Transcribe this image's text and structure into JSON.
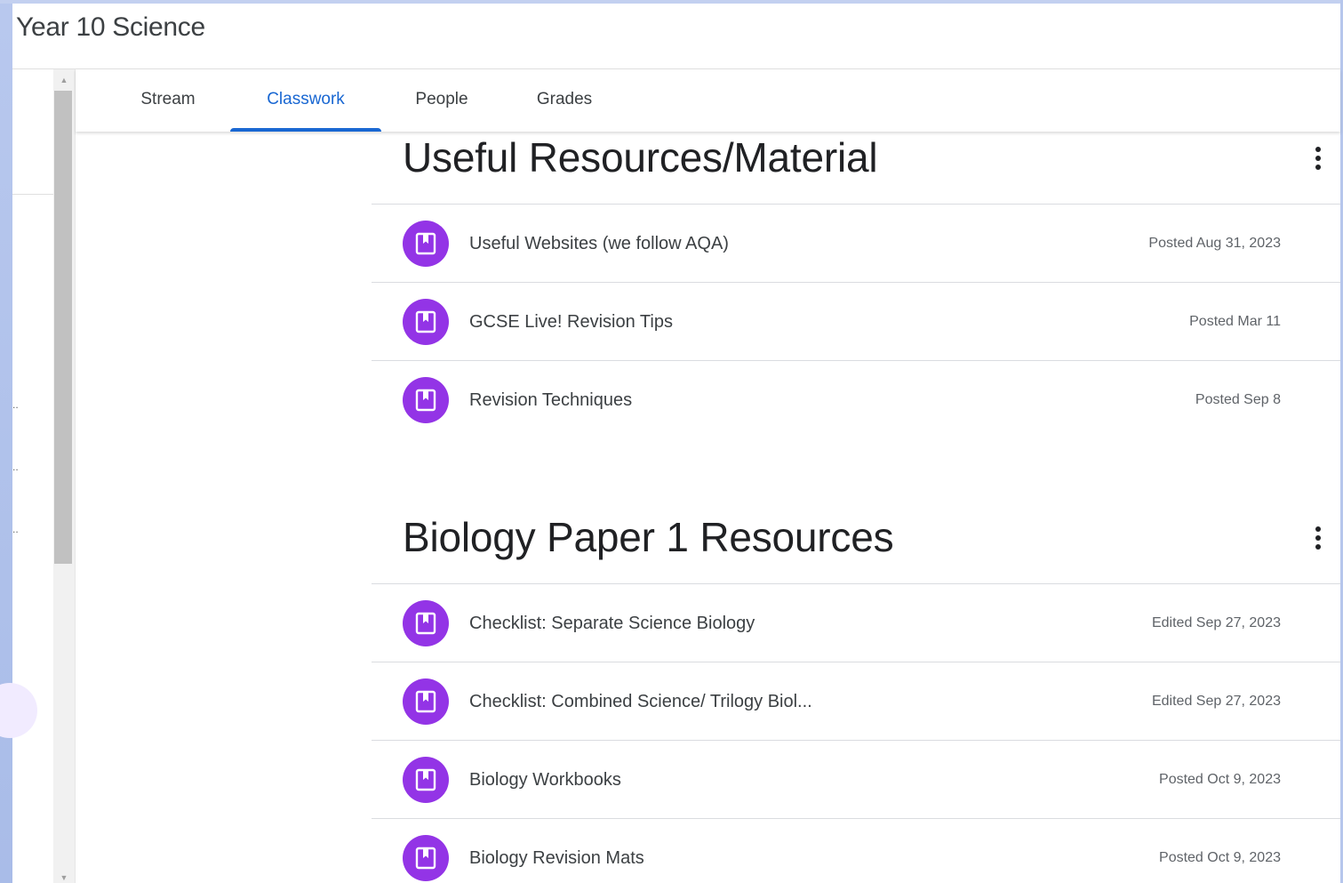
{
  "header": {
    "class_title": "Year 10 Science"
  },
  "tabs": [
    {
      "label": "Stream",
      "active": false
    },
    {
      "label": "Classwork",
      "active": true
    },
    {
      "label": "People",
      "active": false
    },
    {
      "label": "Grades",
      "active": false
    }
  ],
  "topics": [
    {
      "title": "Useful Resources/Material",
      "items": [
        {
          "name": "Useful Websites (we follow AQA)",
          "date": "Posted Aug 31, 2023"
        },
        {
          "name": "GCSE Live! Revision Tips",
          "date": "Posted Mar 11"
        },
        {
          "name": "Revision Techniques",
          "date": "Posted Sep 8"
        }
      ]
    },
    {
      "title": "Biology Paper 1 Resources",
      "items": [
        {
          "name": "Checklist: Separate Science Biology",
          "date": "Edited Sep 27, 2023"
        },
        {
          "name": "Checklist: Combined Science/ Trilogy Biol...",
          "date": "Edited Sep 27, 2023"
        },
        {
          "name": "Biology Workbooks",
          "date": "Posted Oct 9, 2023"
        },
        {
          "name": "Biology Revision Mats",
          "date": "Posted Oct 9, 2023"
        }
      ]
    }
  ],
  "icons": {
    "material_icon": "material-icon",
    "more_icon": "more-vert-icon",
    "scroll_up": "scroll-up-arrow-icon",
    "scroll_down": "scroll-down-arrow-icon"
  },
  "colors": {
    "accent": "#1967d2",
    "material_purple": "#9334e6",
    "desktop_blue": "#b8c8ee"
  },
  "left_nav": {
    "truncation_marks": [
      "..",
      "..",
      ".."
    ]
  },
  "scroll": {
    "up_glyph": "▲",
    "down_glyph": "▼"
  }
}
